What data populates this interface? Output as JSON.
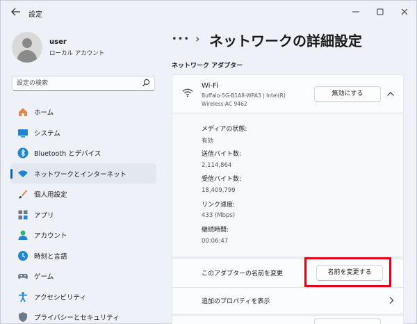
{
  "window": {
    "title": "設定"
  },
  "profile": {
    "name": "user",
    "account_type": "ローカル アカウント"
  },
  "search": {
    "placeholder": "設定の検索"
  },
  "nav": {
    "items": [
      {
        "label": "ホーム",
        "icon": "home-icon"
      },
      {
        "label": "システム",
        "icon": "system-icon"
      },
      {
        "label": "Bluetooth とデバイス",
        "icon": "bluetooth-icon"
      },
      {
        "label": "ネットワークとインターネット",
        "icon": "network-icon",
        "active": true
      },
      {
        "label": "個人用設定",
        "icon": "personalize-icon"
      },
      {
        "label": "アプリ",
        "icon": "apps-icon"
      },
      {
        "label": "アカウント",
        "icon": "account-icon"
      },
      {
        "label": "時刻と言語",
        "icon": "time-language-icon"
      },
      {
        "label": "ゲーム",
        "icon": "gaming-icon"
      },
      {
        "label": "アクセシビリティ",
        "icon": "accessibility-icon"
      },
      {
        "label": "プライバシーとセキュリティ",
        "icon": "privacy-icon"
      }
    ]
  },
  "breadcrumb": {
    "ellipsis": "•••",
    "separator": "›"
  },
  "main": {
    "title": "ネットワークの詳細設定",
    "section_title": "ネットワーク アダプター",
    "adapter": {
      "name": "Wi-Fi",
      "description_line1": "Buffalo-5G-B1A8-WPA3 | Intel(R)",
      "description_line2": "Wireless-AC 9462",
      "disable_label": "無効にする"
    },
    "details": [
      {
        "label": "メディアの状態:",
        "value": "有効"
      },
      {
        "label": "送信バイト数:",
        "value": "2,114,864"
      },
      {
        "label": "受信バイト数:",
        "value": "18,409,799"
      },
      {
        "label": "リンク速度:",
        "value": "433 (Mbps)"
      },
      {
        "label": "継続時間:",
        "value": "00:06:47"
      }
    ],
    "rename": {
      "label": "このアダプターの名前を変更",
      "button_label": "名前を変更する"
    },
    "properties": {
      "label": "追加のプロパティを表示"
    }
  },
  "colors": {
    "accent": "#0067c0",
    "highlight": "#e3001b"
  }
}
